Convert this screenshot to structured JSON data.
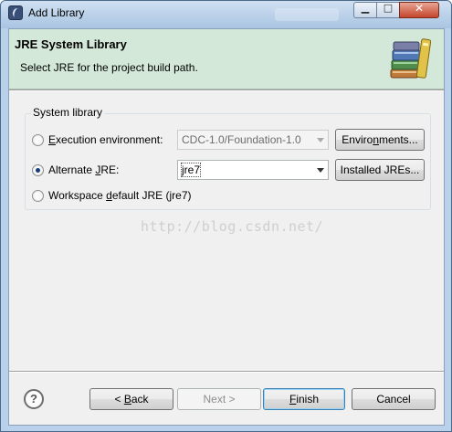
{
  "window": {
    "title": "Add Library"
  },
  "header": {
    "title": "JRE System Library",
    "message": "Select JRE for the project build path."
  },
  "group": {
    "label": "System library",
    "options": [
      {
        "prefix": "",
        "mnemonic": "E",
        "suffix": "xecution environment:",
        "checked": false
      },
      {
        "prefix": "Alternate ",
        "mnemonic": "J",
        "suffix": "RE:",
        "checked": true
      },
      {
        "prefix": "Workspace ",
        "mnemonic": "d",
        "suffix": "efault JRE (jre7)",
        "checked": false
      }
    ],
    "execution_env_combo": "CDC-1.0/Foundation-1.0",
    "alternate_jre_combo": "jre7",
    "environments_button": {
      "prefix": "Enviro",
      "mnemonic": "n",
      "suffix": "ments..."
    },
    "installed_jres_button": "Installed JREs..."
  },
  "watermark": "http://blog.csdn.net/",
  "footer": {
    "help_icon_glyph": "?",
    "back_button": {
      "prefix": "< ",
      "mnemonic": "B",
      "suffix": "ack"
    },
    "next_button": "Next >",
    "finish_button": {
      "mnemonic": "F",
      "suffix": "inish"
    },
    "cancel_button": "Cancel"
  }
}
